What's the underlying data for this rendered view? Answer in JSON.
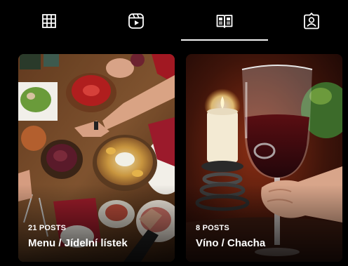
{
  "tabs": [
    {
      "icon": "grid-icon",
      "active": false
    },
    {
      "icon": "reels-icon",
      "active": false
    },
    {
      "icon": "guides-icon",
      "active": true
    },
    {
      "icon": "tagged-icon",
      "active": false
    }
  ],
  "guides": [
    {
      "count_label": "21 POSTS",
      "title": "Menu / Jídelní lístek",
      "image": "food-photo"
    },
    {
      "count_label": "8 POSTS",
      "title": "Víno / Chacha",
      "image": "wine-photo"
    }
  ],
  "colors": {
    "background": "#000000",
    "indicator": "#f2f2f2",
    "text": "#ffffff"
  }
}
